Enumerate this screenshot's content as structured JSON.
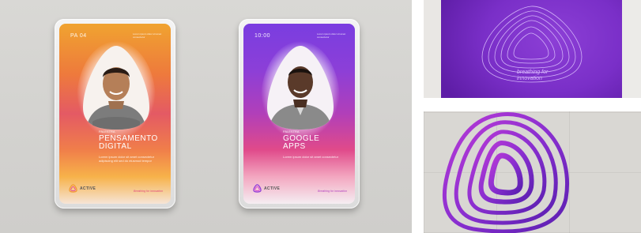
{
  "left_mockup": {
    "card_orange": {
      "code": "PA 04",
      "tiny_info": "Lorem ipsum dolor sit amet consectetur",
      "section": "PALESTRA",
      "title_line1": "PENSAMENTO",
      "title_line2": "DIGITAL",
      "description": "Lorem ipsum dolor sit amet consectetur adipiscing elit sed do eiusmod tempor",
      "brand": "ACTIVE",
      "tagline": "Breathing for innovation"
    },
    "card_purple": {
      "code": "10:00",
      "tiny_info": "Lorem ipsum dolor sit amet consectetur",
      "section": "PALESTRA",
      "title_line1": "GOOGLE",
      "title_line2": "APPS",
      "description": "Lorem ipsum dolor sit amet consectetur",
      "brand": "ACTIVE",
      "tagline": "Breathing for innovation"
    }
  },
  "shirt_mockup": {
    "tagline_line1": "breathing for",
    "tagline_line2": "innovation"
  },
  "colors": {
    "purple": "#7a2fc8",
    "magenta": "#d43ccf",
    "orange": "#f29b33"
  }
}
